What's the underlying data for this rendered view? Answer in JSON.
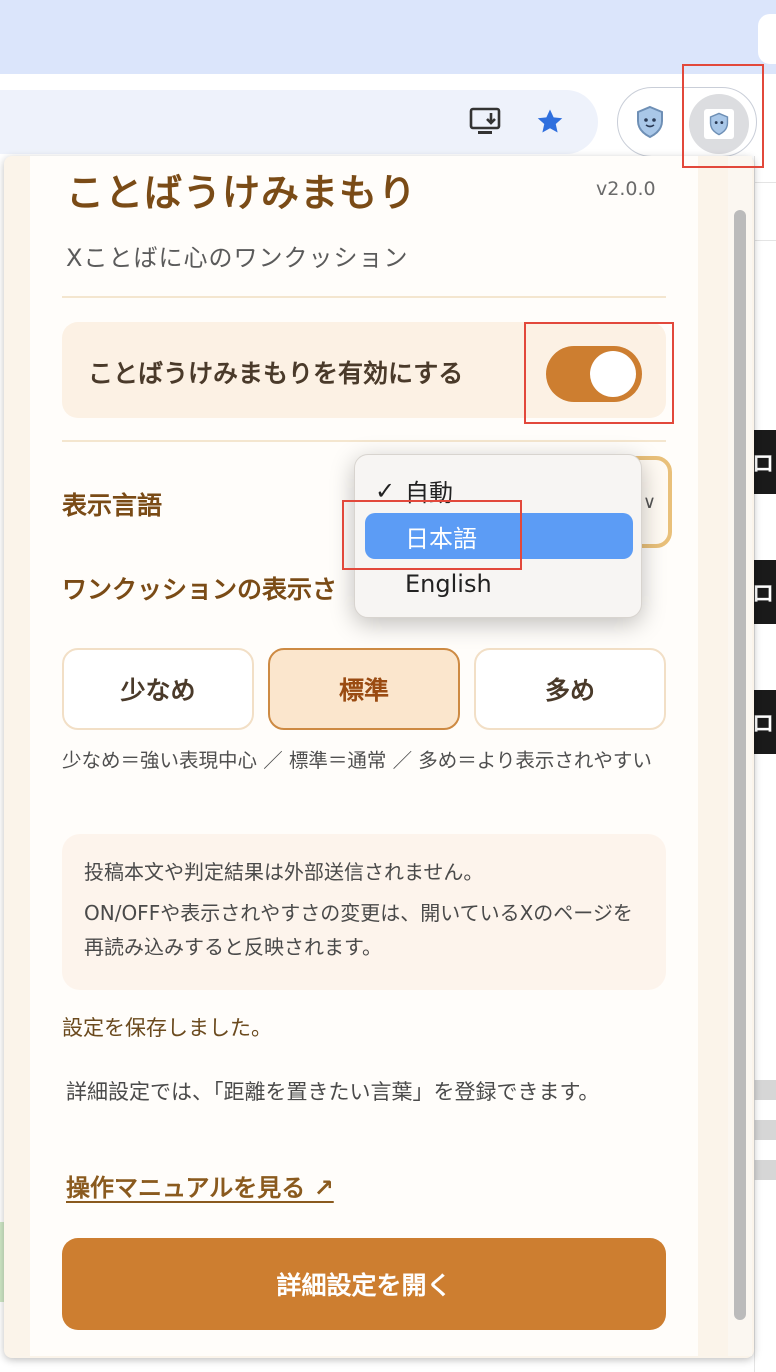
{
  "browser": {
    "extension_icons": [
      "shield-mascot-icon",
      "shield-mascot-icon"
    ]
  },
  "popup": {
    "title": "ことばうけみまもり",
    "version": "v2.0.0",
    "subtitle": "Xことばに心のワンクッション",
    "enable": {
      "label": "ことばうけみまもりを有効にする",
      "checked": true
    },
    "language": {
      "label": "表示言語",
      "options": [
        "自動",
        "日本語",
        "English"
      ],
      "checked_option": "自動",
      "highlighted_option": "日本語"
    },
    "visibility": {
      "label": "ワンクッションの表示さ",
      "options": [
        "少なめ",
        "標準",
        "多め"
      ],
      "selected": "標準",
      "hint": "少なめ＝強い表現中心 ／ 標準＝通常 ／ 多め＝より表示されやすい"
    },
    "notice": {
      "line1": "投稿本文や判定結果は外部送信されません。",
      "line2": "ON/OFFや表示されやすさの変更は、開いているXのページを再読み込みすると反映されます。"
    },
    "status": "設定を保存しました。",
    "advanced_note": "詳細設定では、「距離を置きたい言葉」を登録できます。",
    "manual_link": "操作マニュアルを見る ↗",
    "open_settings_button": "詳細設定を開く"
  },
  "colors": {
    "accent": "#cd7e30",
    "title": "#7a4b16",
    "highlight": "#5c9cf5",
    "annotation": "#e2483b"
  }
}
